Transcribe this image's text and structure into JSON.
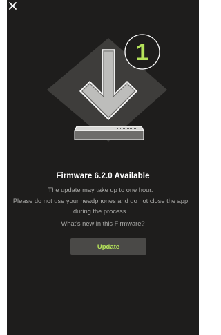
{
  "header": {
    "close_icon": "close-icon"
  },
  "hero": {
    "illustration": "firmware-download-illustration",
    "step_number": "1",
    "accent_color": "#b5e35a"
  },
  "content": {
    "title": "Firmware 6.2.0 Available",
    "description_lines": [
      "The update may take up to one hour.",
      "Please do not use your headphones and do not close the app",
      "during the process."
    ],
    "link_text": "What's new in this Firmware?"
  },
  "actions": {
    "update_label": "Update",
    "button_color": "#4a4947"
  }
}
